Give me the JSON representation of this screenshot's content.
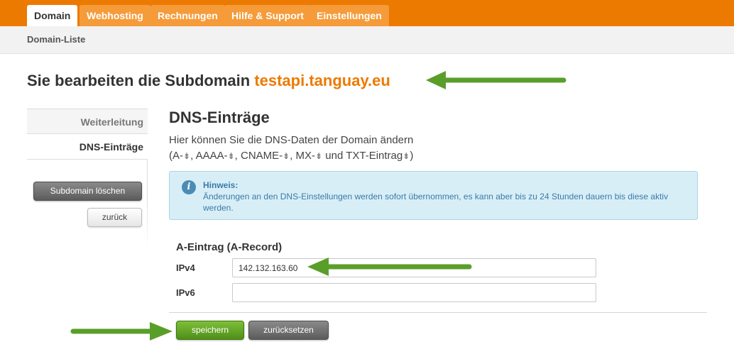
{
  "nav": {
    "tabs": [
      {
        "label": "Domain",
        "active": true
      },
      {
        "label": "Webhosting",
        "active": false
      },
      {
        "label": "Rechnungen",
        "active": false
      },
      {
        "label": "Hilfe & Support",
        "active": false
      },
      {
        "label": "Einstellungen",
        "active": false
      }
    ],
    "breadcrumb": "Domain-Liste"
  },
  "heading": {
    "prefix": "Sie bearbeiten die Subdomain",
    "subdomain": "testapi.tanguay.eu"
  },
  "sidebar": {
    "items": [
      {
        "label": "Weiterleitung",
        "active": false
      },
      {
        "label": "DNS-Einträge",
        "active": true
      }
    ],
    "delete_button": "Subdomain löschen",
    "back_button": "zurück"
  },
  "main": {
    "title": "DNS-Einträge",
    "intro_line1": "Hier können Sie die DNS-Daten der Domain ändern",
    "intro_line2": {
      "open": "(A-",
      "aaaa": ", AAAA-",
      "cname": ", CNAME-",
      "mx": ", MX-",
      "txt": " und TXT-Eintrag",
      "close": ")"
    },
    "download_icon_glyph": "⇟",
    "notice": {
      "icon": "info-icon",
      "title": "Hinweis:",
      "text": "Änderungen an den DNS-Einstellungen werden sofort übernommen, es kann aber bis zu 24 Stunden dauern bis diese aktiv werden."
    },
    "record": {
      "title": "A-Eintrag (A-Record)",
      "ipv4_label": "IPv4",
      "ipv4_value": "142.132.163.60",
      "ipv6_label": "IPv6",
      "ipv6_value": ""
    },
    "save_button": "speichern",
    "reset_button": "zurücksetzen"
  },
  "colors": {
    "brand_orange": "#ed7a00",
    "annotation_arrow": "#5a9e2a"
  }
}
